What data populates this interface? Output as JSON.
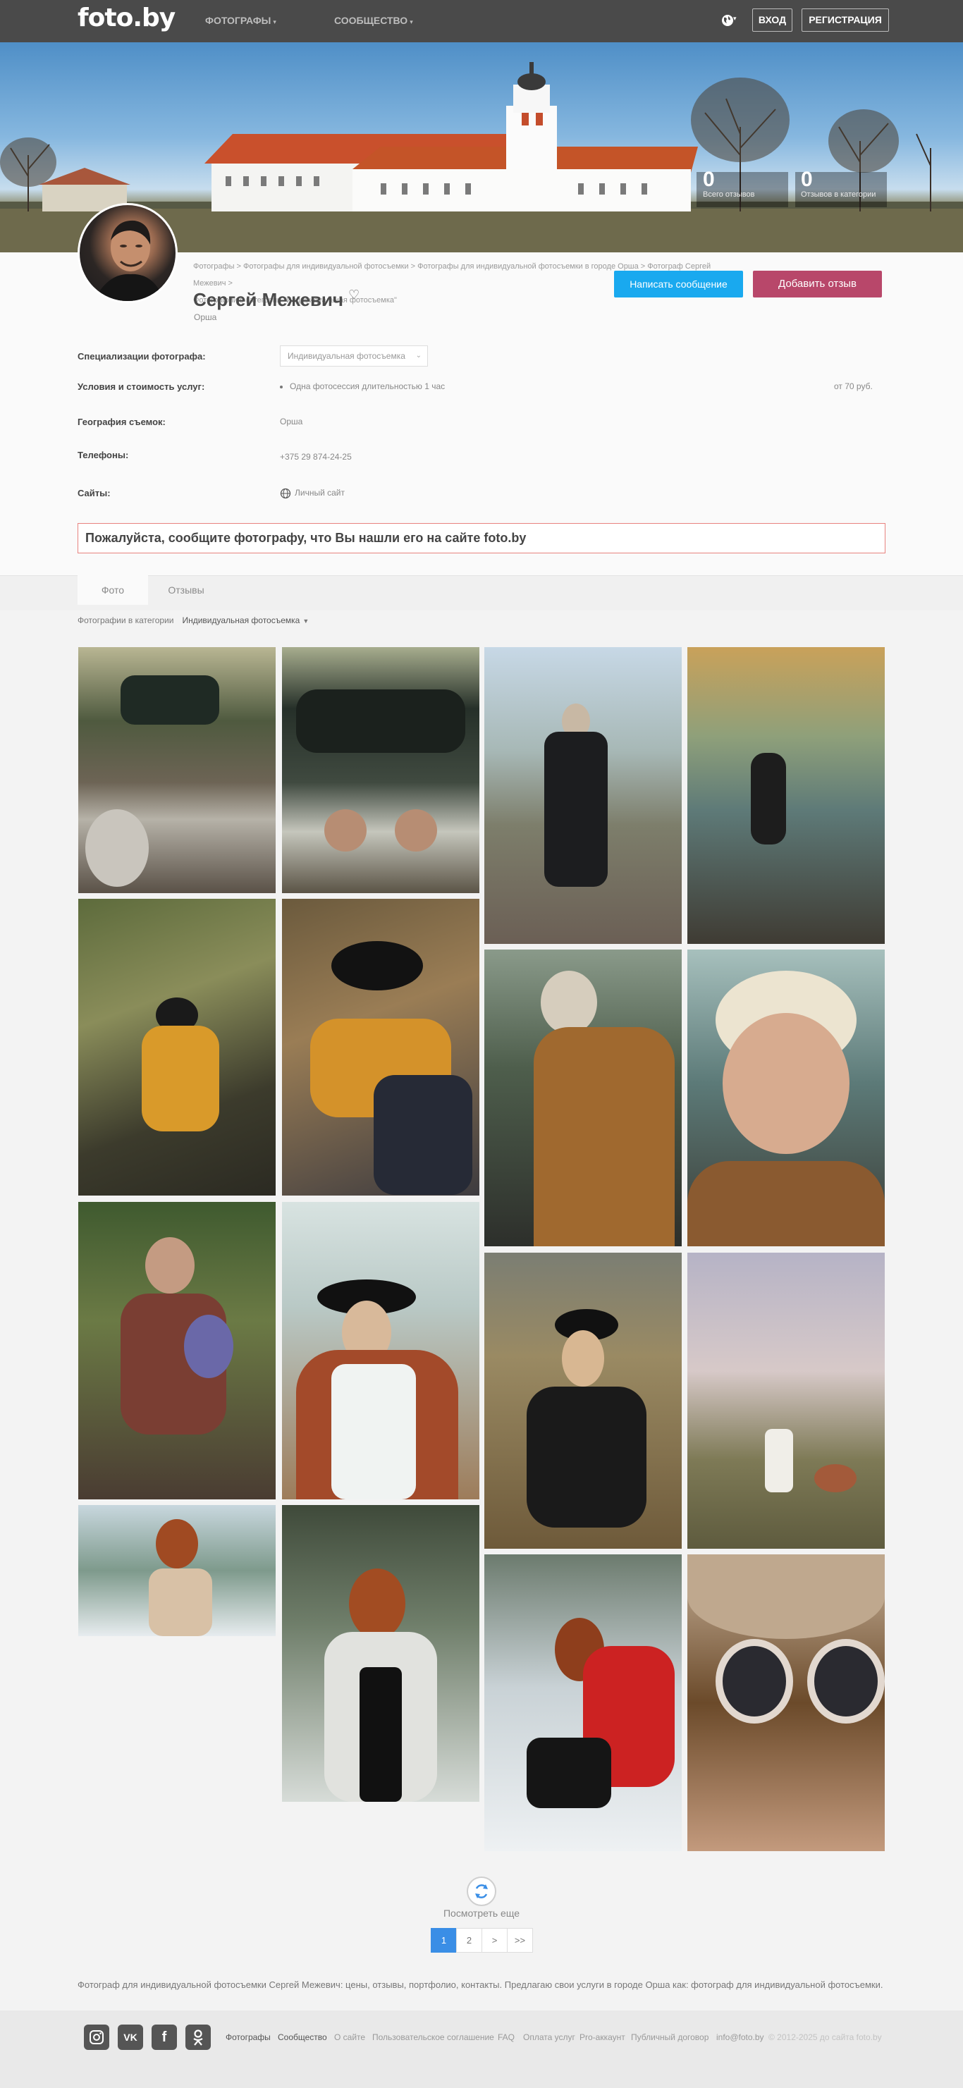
{
  "header": {
    "logo": "foto.by",
    "nav": [
      "ФОТОГРАФЫ",
      "СООБЩЕСТВО"
    ],
    "login_label": "ВХОД",
    "register_label": "РЕГИСТРАЦИЯ"
  },
  "cover": {
    "stats": [
      {
        "num": "0",
        "label": "Всего отзывов"
      },
      {
        "num": "0",
        "label": "Отзывов в категории"
      }
    ]
  },
  "profile": {
    "breadcrumb_line1": "Фотографы > Фотографы для индивидуальной фотосъемки > Фотографы для индивидуальной фотосъемки в городе Орша > Фотограф Сергей Межевич >",
    "breadcrumb_line2": "Фотографии в категории \"Индивидуальная фотосъемка\"",
    "name": "Сергей Межевич",
    "city": "Орша",
    "message_button": "Написать сообщение",
    "review_button": "Добавить отзыв",
    "specializations_label": "Специализации фотографа:",
    "specialization_value": "Индивидуальная фотосъемка",
    "services_label": "Условия и стоимость услуг:",
    "service_name": "Одна фотосессия длительностью 1 час",
    "service_price": "от 70 руб.",
    "geo_label": "География съемок:",
    "geo_value": "Орша",
    "phones_label": "Телефоны:",
    "phone_value": "+375 29 874-24-25",
    "sites_label": "Сайты:",
    "site_value": "Личный сайт",
    "notice": "Пожалуйста, сообщите фотографу, что Вы нашли его на сайте foto.by"
  },
  "tabs": [
    "Фото",
    "Отзывы"
  ],
  "category": {
    "label": "Фотографии в категории",
    "selected": "Индивидуальная фотосъемка"
  },
  "load_more": "Посмотреть еще",
  "pagination": [
    "1",
    "2",
    ">",
    ">>"
  ],
  "seo_text": "Фотограф для индивидуальной фотосъемки Сергей Межевич: цены, отзывы, портфолио, контакты. Предлагаю свои услуги в городе Орша как: фотограф для индивидуальной фотосъемки.",
  "footer": {
    "social": [
      "instagram-icon",
      "vk-icon",
      "facebook-icon",
      "odnoklassniki-icon"
    ],
    "links": [
      "Фотографы",
      "Сообщество",
      "О сайте",
      "Пользовательское соглашение",
      "FAQ",
      "Оплата услуг",
      "Pro-аккаунт",
      "Публичный договор",
      "info@foto.by",
      "© 2012-2025 до сайта foto.by"
    ]
  },
  "colors": {
    "header_bg": "#4a4a4a",
    "message_button": "#19a9ef",
    "review_button": "#b8476a",
    "notice_border": "#e8827e",
    "pager_active": "#3a8ee6"
  }
}
